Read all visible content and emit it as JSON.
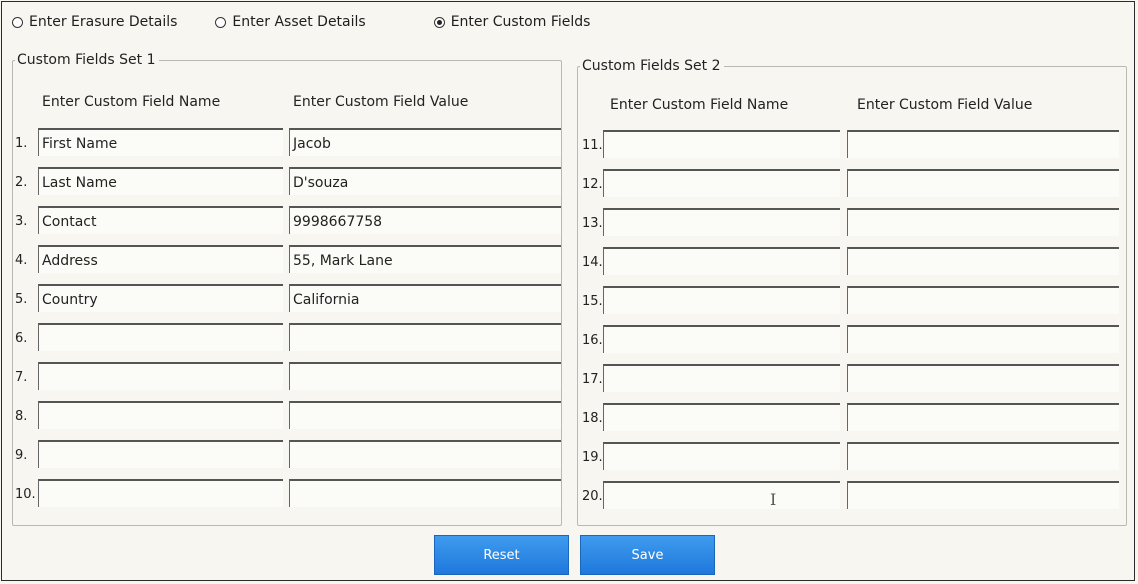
{
  "modes": [
    {
      "label": "Enter Erasure Details",
      "checked": false
    },
    {
      "label": "Enter Asset Details",
      "checked": false
    },
    {
      "label": "Enter Custom Fields",
      "checked": true
    }
  ],
  "set1": {
    "title": "Custom Fields Set 1",
    "name_header": "Enter Custom Field Name",
    "value_header": "Enter Custom Field Value",
    "rows": [
      {
        "num": "1.",
        "name": "First Name",
        "value": "Jacob"
      },
      {
        "num": "2.",
        "name": "Last Name",
        "value": "D'souza"
      },
      {
        "num": "3.",
        "name": "Contact",
        "value": "9998667758"
      },
      {
        "num": "4.",
        "name": "Address",
        "value": "55, Mark Lane"
      },
      {
        "num": "5.",
        "name": "Country",
        "value": "California"
      },
      {
        "num": "6.",
        "name": "",
        "value": ""
      },
      {
        "num": "7.",
        "name": "",
        "value": ""
      },
      {
        "num": "8.",
        "name": "",
        "value": ""
      },
      {
        "num": "9.",
        "name": "",
        "value": ""
      },
      {
        "num": "10.",
        "name": "",
        "value": ""
      }
    ]
  },
  "set2": {
    "title": "Custom Fields Set 2",
    "name_header": "Enter Custom Field Name",
    "value_header": "Enter Custom Field Value",
    "rows": [
      {
        "num": "11.",
        "name": "",
        "value": ""
      },
      {
        "num": "12.",
        "name": "",
        "value": ""
      },
      {
        "num": "13.",
        "name": "",
        "value": ""
      },
      {
        "num": "14.",
        "name": "",
        "value": ""
      },
      {
        "num": "15.",
        "name": "",
        "value": ""
      },
      {
        "num": "16.",
        "name": "",
        "value": ""
      },
      {
        "num": "17.",
        "name": "",
        "value": ""
      },
      {
        "num": "18.",
        "name": "",
        "value": ""
      },
      {
        "num": "19.",
        "name": "",
        "value": ""
      },
      {
        "num": "20.",
        "name": "",
        "value": ""
      }
    ]
  },
  "buttons": {
    "reset": "Reset",
    "save": "Save"
  },
  "colors": {
    "button": "#2a86e6",
    "background": "#f7f6f1"
  }
}
